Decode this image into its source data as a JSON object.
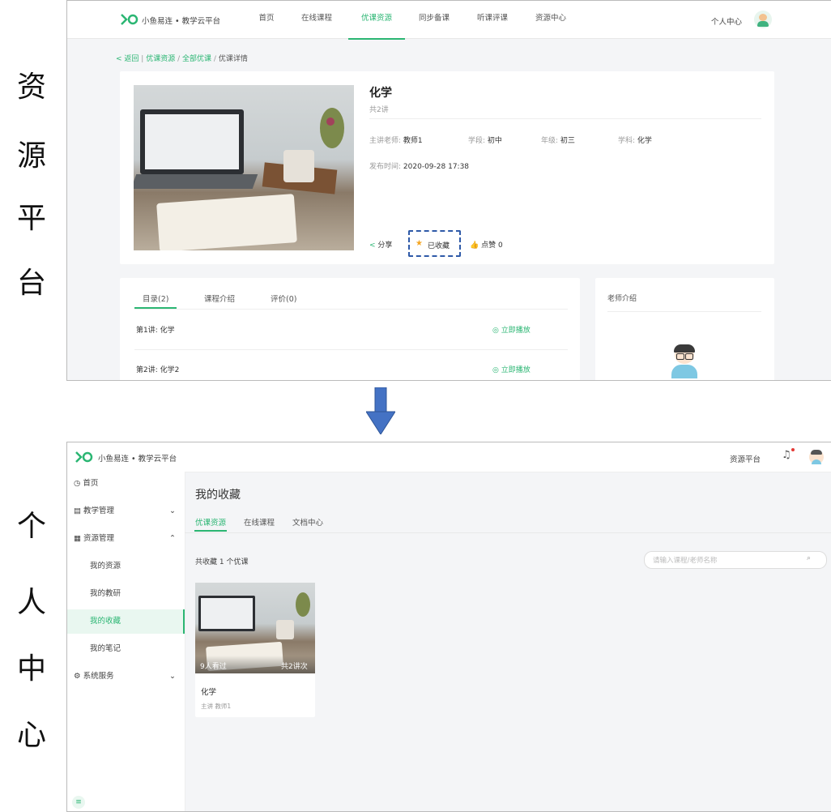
{
  "labels": {
    "resource_platform": [
      "资",
      "源",
      "平",
      "台"
    ],
    "personal_center": [
      "个",
      "人",
      "中",
      "心"
    ]
  },
  "top": {
    "brand": "小鱼易连 • 教学云平台",
    "nav": [
      "首页",
      "在线课程",
      "优课资源",
      "同步备课",
      "听课评课",
      "资源中心"
    ],
    "active_nav": "优课资源",
    "personal_center": "个人中心",
    "breadcrumb": {
      "back": "< 返回",
      "sep": "/",
      "items": [
        "优课资源",
        "全部优课",
        "优课详情"
      ]
    },
    "course": {
      "title": "化学",
      "lectures": "共2讲",
      "teacher_label": "主讲老师:",
      "teacher": "教师1",
      "stage_label": "学段:",
      "stage": "初中",
      "grade_label": "年级:",
      "grade": "初三",
      "subject_label": "学科:",
      "subject": "化学",
      "publish_label": "发布时间:",
      "publish_time": "2020-09-28 17:38"
    },
    "actions": {
      "share": "分享",
      "favorited": "已收藏",
      "like": "点赞 0"
    },
    "tabs": [
      "目录(2)",
      "课程介绍",
      "评价(0)"
    ],
    "lessons": [
      {
        "title": "第1讲: 化学",
        "play": "立即播放"
      },
      {
        "title": "第2讲: 化学2",
        "play": "立即播放"
      }
    ],
    "teacher_intro": "老师介绍",
    "colors": {
      "accent": "#2bb673",
      "highlight_box": "#2f5aa8",
      "star": "#f5a623"
    }
  },
  "bottom": {
    "brand": "小鱼易连 • 教学云平台",
    "resource_platform": "资源平台",
    "sidebar": [
      {
        "label": "首页",
        "icon": "clock-icon"
      },
      {
        "label": "教学管理",
        "icon": "book-icon",
        "chevron": "down"
      },
      {
        "label": "资源管理",
        "icon": "grid-icon",
        "chevron": "up",
        "active": true
      },
      {
        "label": "我的资源",
        "sub": true
      },
      {
        "label": "我的教研",
        "sub": true
      },
      {
        "label": "我的收藏",
        "sub": true,
        "selected": true
      },
      {
        "label": "我的笔记",
        "sub": true
      },
      {
        "label": "系统服务",
        "icon": "gear-icon",
        "chevron": "down"
      }
    ],
    "page_title": "我的收藏",
    "tabs": [
      "优课资源",
      "在线课程",
      "文档中心"
    ],
    "count_text": "共收藏 1 个优课",
    "search_placeholder": "请输入课程/老师名称",
    "card": {
      "viewed": "9人看过",
      "lessons": "共2讲次",
      "title": "化学",
      "teacher_label": "主讲",
      "teacher": "教师1"
    }
  },
  "arrow": {
    "color": "#4472c4"
  }
}
